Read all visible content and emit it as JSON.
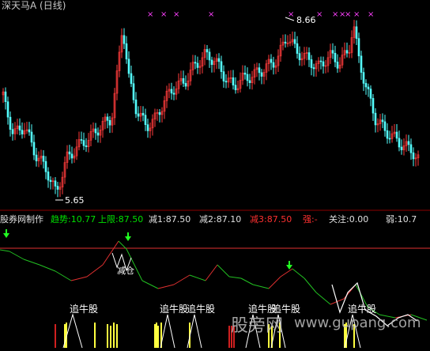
{
  "title": "深天马A (日线)",
  "price_labels": {
    "high": "8.66",
    "low": "5.65"
  },
  "indicator_header": {
    "name": "股券网制作",
    "items": [
      {
        "label": "趋势:",
        "value": "10.77",
        "color": "#00e000"
      },
      {
        "label": "上限:",
        "value": "87.50",
        "color": "#00e000"
      },
      {
        "label": "减1:",
        "value": "87.50",
        "color": "#e0e0e0"
      },
      {
        "label": "减2:",
        "value": "87.10",
        "color": "#e0e0e0"
      },
      {
        "label": "减3:",
        "value": "87.50",
        "color": "#ff3030"
      },
      {
        "label": "强:",
        "value": "-",
        "color": "#ff3030"
      },
      {
        "label": "关注:",
        "value": "0.00",
        "color": "#e0e0e0"
      },
      {
        "label": "弱:",
        "value": "10.7",
        "color": "#e0e0e0"
      }
    ]
  },
  "annotations": {
    "jiecang": "减仓",
    "zhuiniu_1": "追牛股",
    "zhuiniu_2": "追牛股",
    "zhuiniu_3": "追牛股",
    "zhuiniu_4": "追牛股",
    "zhuiniu_5": "追牛股",
    "zhuiniu_6": "追牛股"
  },
  "watermark": {
    "cn": "股旁网",
    "en": "www.gupang.com"
  },
  "colors": {
    "up": "#ff3b3b",
    "down": "#54ffff",
    "trend_up": "#e03030",
    "trend_down": "#22c022",
    "limit_line": "#e03030",
    "magenta": "#ff40ff",
    "arrow": "#22ff22",
    "yellow": "#ffff40"
  }
}
